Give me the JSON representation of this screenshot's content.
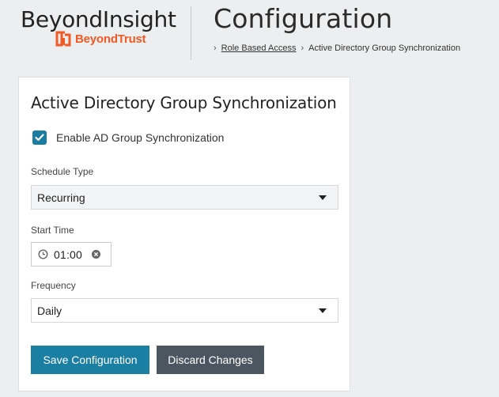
{
  "header": {
    "brand_name": "BeyondInsight",
    "brand_logo_text": "BeyondTrust",
    "page_title": "Configuration",
    "breadcrumb": [
      "Role Based Access",
      "Active Directory Group Synchronization"
    ]
  },
  "card": {
    "title": "Active Directory Group Synchronization",
    "enable_label": "Enable AD Group Synchronization",
    "enable_checked": true,
    "schedule_type_label": "Schedule Type",
    "schedule_type_value": "Recurring",
    "start_time_label": "Start Time",
    "start_time_value": "01:00",
    "frequency_label": "Frequency",
    "frequency_value": "Daily"
  },
  "buttons": {
    "save_label": "Save Configuration",
    "discard_label": "Discard Changes"
  },
  "colors": {
    "accent": "#1b7ea3",
    "brand_orange": "#f15a24",
    "discard": "#4b5660"
  },
  "icons": {
    "check": "checkmark-icon",
    "clock": "clock-icon",
    "clear": "clear-circle-icon",
    "caret": "chevron-down-icon"
  }
}
